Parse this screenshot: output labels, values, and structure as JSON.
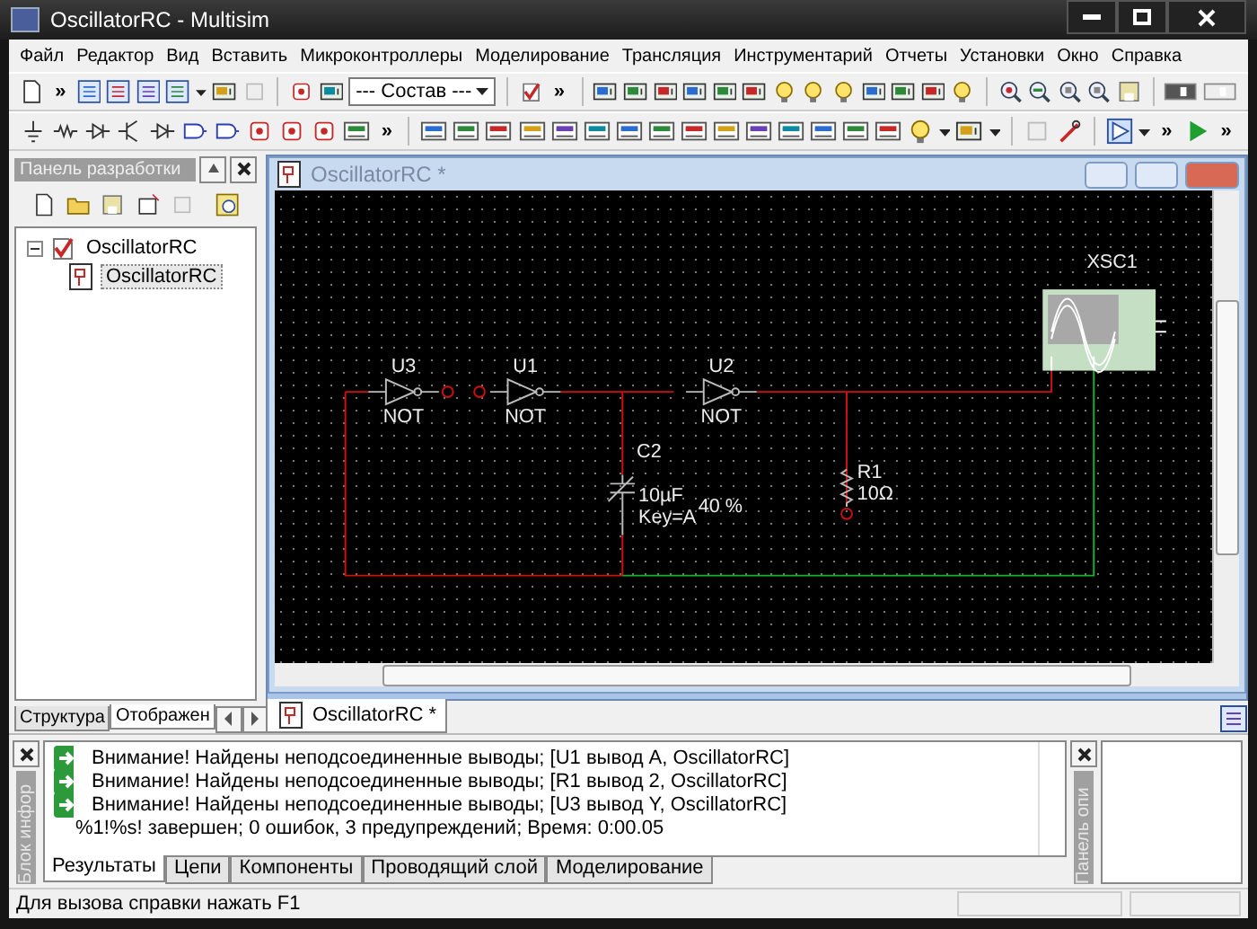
{
  "window": {
    "title": "OscillatorRC - Multisim"
  },
  "menu": [
    "Файл",
    "Редактор",
    "Вид",
    "Вставить",
    "Микроконтроллеры",
    "Моделирование",
    "Трансляция",
    "Инструментарий",
    "Отчеты",
    "Установки",
    "Окно",
    "Справка"
  ],
  "toolbar_1": {
    "chevrons": [
      "»",
      "»"
    ],
    "dropdown": "--- Состав ---"
  },
  "toolbar_2": {
    "chevrons": [
      "»",
      "»",
      "»"
    ]
  },
  "design_panel": {
    "title": "Панель разработки",
    "tree": [
      {
        "label": "OscillatorRC",
        "expanded": true,
        "selected": false,
        "children": [
          {
            "label": "OscillatorRC",
            "selected": true
          }
        ]
      }
    ],
    "tabs": [
      {
        "label": "Структура",
        "selected": false
      },
      {
        "label": "Отображен",
        "selected": true
      }
    ]
  },
  "schematic": {
    "title": "OscillatorRC *",
    "labels": {
      "u3": "U3",
      "u3_type": "NOT",
      "u1": "U1",
      "u1_type": "NOT",
      "u2": "U2",
      "u2_type": "NOT",
      "c2": "C2",
      "c2_value": "10µF",
      "c2_key": "Key=A",
      "c2_percent": "40 %",
      "r1": "R1",
      "r1_value": "10Ω",
      "xsc1": "XSC1"
    }
  },
  "document_tabs": [
    {
      "label": "OscillatorRC *",
      "selected": true
    }
  ],
  "results": {
    "side_label": "Блок инфор",
    "rows": [
      {
        "kind": "warning",
        "text": "Внимание! Найдены неподсоединенные выводы;  [U1 вывод A, OscillatorRC]"
      },
      {
        "kind": "warning",
        "text": "Внимание! Найдены неподсоединенные выводы;  [R1 вывод 2, OscillatorRC]"
      },
      {
        "kind": "warning",
        "text": "Внимание! Найдены неподсоединенные выводы;  [U3 вывод Y, OscillatorRC]"
      },
      {
        "kind": "summary",
        "text": "%1!%s! завершен;  0 ошибок, 3 предупреждений;  Время: 0:00.05"
      }
    ],
    "tabs": [
      {
        "label": "Результаты",
        "selected": true
      },
      {
        "label": "Цепи",
        "selected": false
      },
      {
        "label": "Компоненты",
        "selected": false
      },
      {
        "label": "Проводящий слой",
        "selected": false
      },
      {
        "label": "Моделирование",
        "selected": false
      }
    ]
  },
  "description_panel": {
    "side_label": "Панель опи"
  },
  "status_bar": {
    "text": "Для вызова справки нажать F1"
  }
}
